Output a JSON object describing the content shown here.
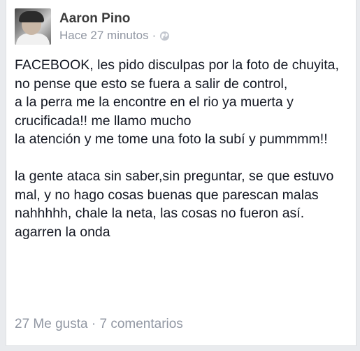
{
  "post": {
    "author": "Aaron Pino",
    "time": "Hace 27 minutos",
    "separator": "·",
    "privacy_icon": "globe-icon",
    "paragraph1": [
      "FACEBOOK, les pido disculpas por la foto de chuyita,",
      "no pense que esto se fuera a salir de control,",
      "a la perra me la encontre en el rio ya muerta y crucificada!! me llamo mucho",
      "la atención y me tome una foto la subí y pummmm!!"
    ],
    "paragraph2": [
      "la gente ataca sin saber,sin preguntar, se que estuvo mal, y no hago cosas buenas que parescan malas nahhhhh, chale la neta, las cosas no fueron así.",
      "agarren la onda"
    ],
    "likes": "27 Me gusta",
    "footer_separator": "·",
    "comments": "7 comentarios"
  }
}
